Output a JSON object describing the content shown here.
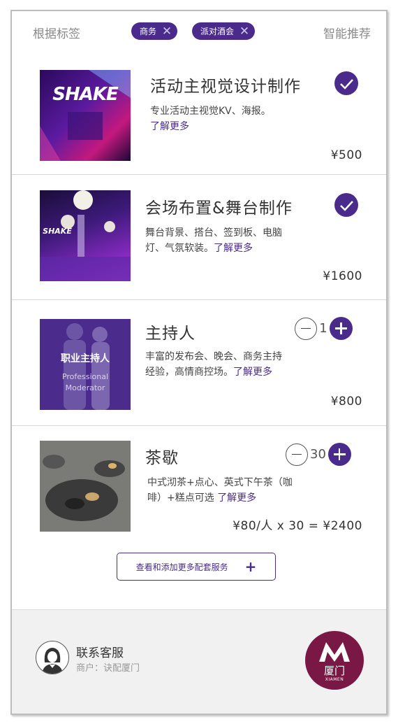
{
  "header": {
    "left_label": "根据标签",
    "right_label": "智能推荐",
    "tags": [
      {
        "label": "商务"
      },
      {
        "label": "派对酒会"
      }
    ]
  },
  "services": [
    {
      "title": "活动主视觉设计制作",
      "desc": "专业活动主视觉KV、海报。",
      "more": "了解更多",
      "price": "¥500",
      "selected": true,
      "thumb_text": "SHAKE"
    },
    {
      "title": "会场布置&舞台制作",
      "desc_line1": "舞台背景、搭台、签到板、电脑",
      "desc_line2": "灯、气氛软装。",
      "more": "了解更多",
      "price": "¥1600",
      "selected": true,
      "thumb_text": "SHAKE"
    },
    {
      "title": "主持人",
      "desc_line1": "丰富的发布会、晚会、商务主持",
      "desc_line2": "经验，高情商控场。",
      "more": "了解更多",
      "price": "¥800",
      "quantity": "1",
      "thumb_title": "职业主持人",
      "thumb_en1": "Professional",
      "thumb_en2": "Moderator"
    },
    {
      "title": "茶歇",
      "desc_line1": "中式沏茶+点心、英式下午茶（咖",
      "desc_line2": "啡）+糕点可选",
      "more": "了解更多",
      "price": "¥80/人 x 30 = ¥2400",
      "quantity": "30"
    }
  ],
  "add_more_label": "查看和添加更多配套服务",
  "add_more_icon": "+",
  "support": {
    "title": "联系客服",
    "subtitle": "商户：诀配厦门"
  },
  "logo": {
    "city": "厦门",
    "en": "XIAMEN"
  },
  "colors": {
    "accent": "#4a2b8c",
    "logo_bg": "#7a1845"
  }
}
